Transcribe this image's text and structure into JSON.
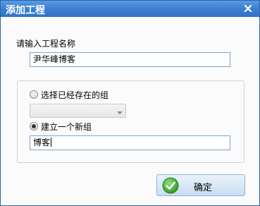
{
  "window": {
    "title": "添加工程",
    "close_icon": "close-icon"
  },
  "project": {
    "name_label": "请输入工程名称",
    "name_value": "尹华峰博客"
  },
  "group": {
    "existing_label": "选择已经存在的组",
    "existing_checked": false,
    "existing_select_value": "",
    "new_label": "建立一个新组",
    "new_checked": true,
    "new_value": "博客"
  },
  "buttons": {
    "ok_label": "确定",
    "ok_icon": "check-icon"
  },
  "colors": {
    "titlebar": "#3f82d4",
    "input_border": "#7da2ce",
    "ok_icon_green": "#3aa52f"
  }
}
